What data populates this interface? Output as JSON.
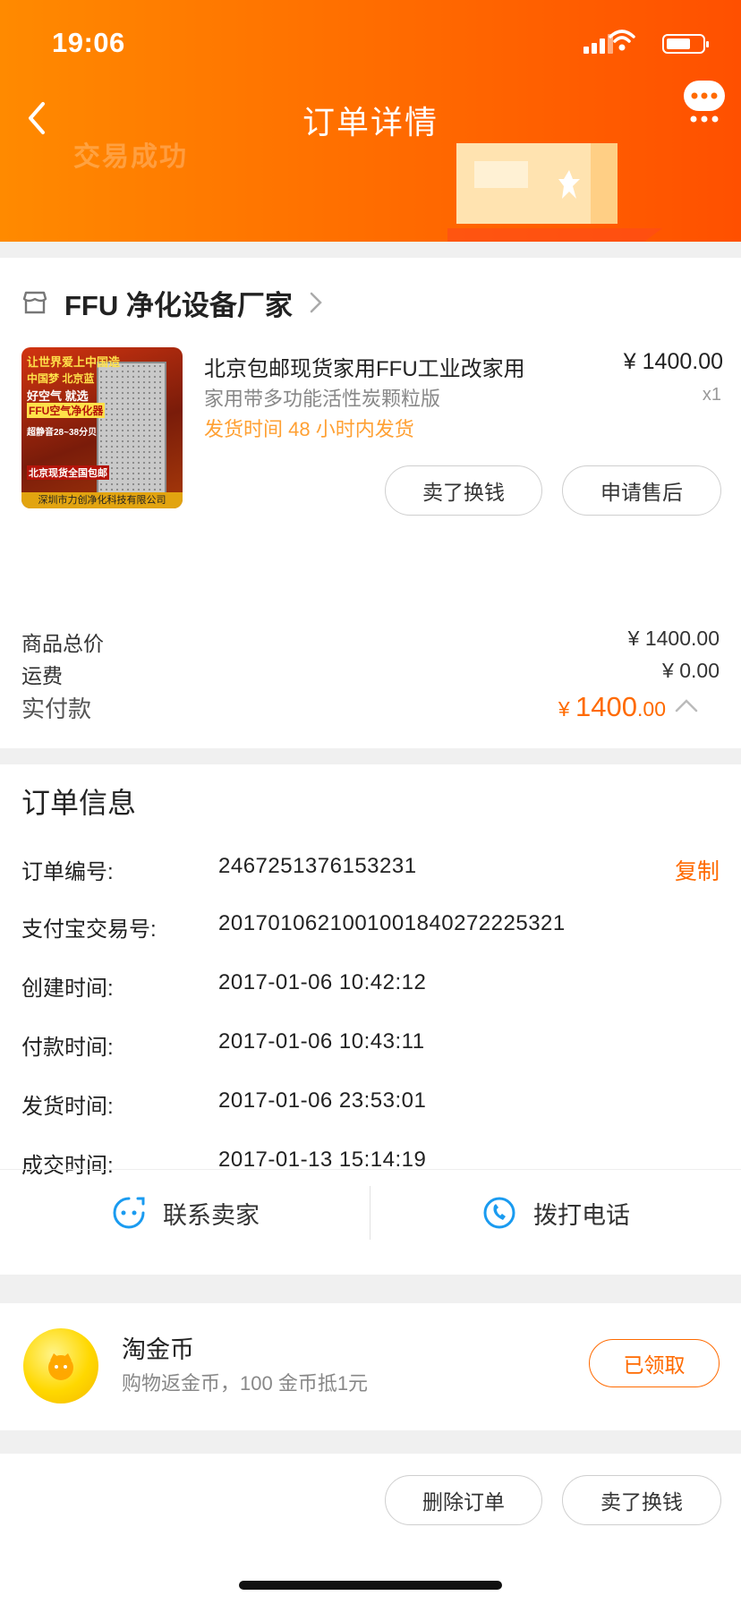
{
  "status_bar": {
    "time": "19:06"
  },
  "nav": {
    "title": "订单详情"
  },
  "header_decor_text": "交易成功",
  "store": {
    "name": "FFU 净化设备厂家"
  },
  "product": {
    "image_lines": [
      "让世界爱上中国造",
      "中国梦 北京蓝",
      "好空气 就选",
      "FFU空气净化器",
      "超静音28~38分贝",
      "北京现货全国包邮",
      "深圳市力创净化科技有限公司"
    ],
    "title": "北京包邮现货家用FFU工业改家用",
    "spec": "家用带多功能活性炭颗粒版",
    "ship_time": "发货时间  48 小时内发货",
    "price": "¥ 1400.00",
    "qty": "x1"
  },
  "product_actions": {
    "resell": "卖了换钱",
    "after_sale": "申请售后"
  },
  "summary": {
    "goods_total_label": "商品总价",
    "goods_total": "¥ 1400.00",
    "shipping_label": "运费",
    "shipping": "¥ 0.00",
    "paid_label": "实付款",
    "paid_symbol": "¥ ",
    "paid_int": "1400",
    "paid_dec": ".00"
  },
  "order_info": {
    "title": "订单信息",
    "copy_label": "复制",
    "rows": [
      {
        "label": "订单编号:",
        "value": "2467251376153231"
      },
      {
        "label": "支付宝交易号:",
        "value": "2017010621001001840272225321"
      },
      {
        "label": "创建时间:",
        "value": "2017-01-06 10:42:12"
      },
      {
        "label": "付款时间:",
        "value": "2017-01-06 10:43:11"
      },
      {
        "label": "发货时间:",
        "value": "2017-01-06 23:53:01"
      },
      {
        "label": "成交时间:",
        "value": "2017-01-13 15:14:19"
      }
    ],
    "contact_seller": "联系卖家",
    "call_phone": "拨打电话"
  },
  "coin": {
    "title": "淘金币",
    "subtitle": "购物返金币，100 金币抵1元",
    "button": "已领取"
  },
  "bottom_actions": {
    "delete_order": "删除订单",
    "resell": "卖了换钱"
  },
  "colors": {
    "accent": "#ff6a00",
    "ship_text": "#ffa033",
    "header_start": "#ff8a00",
    "header_end": "#ff5000"
  }
}
